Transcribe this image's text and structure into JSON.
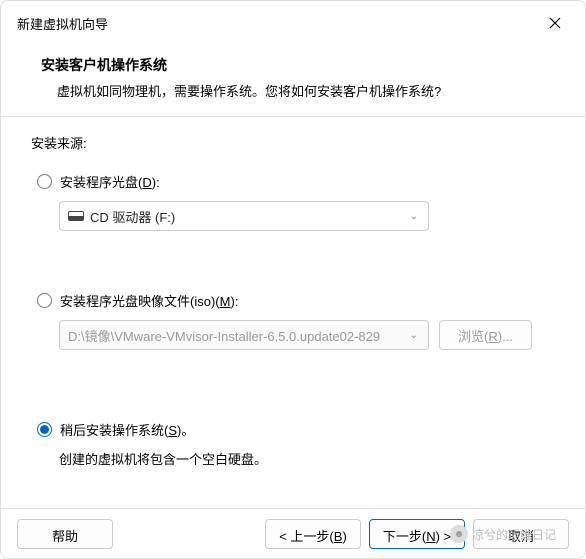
{
  "titlebar": {
    "title": "新建虚拟机向导"
  },
  "header": {
    "title": "安装客户机操作系统",
    "subtitle": "虚拟机如同物理机，需要操作系统。您将如何安装客户机操作系统?"
  },
  "sourceLabel": "安装来源:",
  "options": {
    "disc": {
      "label": "安装程序光盘(",
      "key": "D",
      "label2": "):",
      "dropdown": "CD 驱动器 (F:)"
    },
    "iso": {
      "label": "安装程序光盘映像文件(iso)(",
      "key": "M",
      "label2": "):",
      "path": "D:\\镜像\\VMware-VMvisor-Installer-6.5.0.update02-829",
      "browse": "浏览(",
      "browseKey": "R",
      "browse2": ")..."
    },
    "later": {
      "label": "稍后安装操作系统(",
      "key": "S",
      "label2": ")。",
      "desc": "创建的虚拟机将包含一个空白硬盘。"
    }
  },
  "footer": {
    "help": "帮助",
    "back": "< 上一步(",
    "backKey": "B",
    "back2": ")",
    "next": "下一步(",
    "nextKey": "N",
    "next2": ") >",
    "cancel": "取消"
  },
  "watermark": "凉兮的运维日记"
}
